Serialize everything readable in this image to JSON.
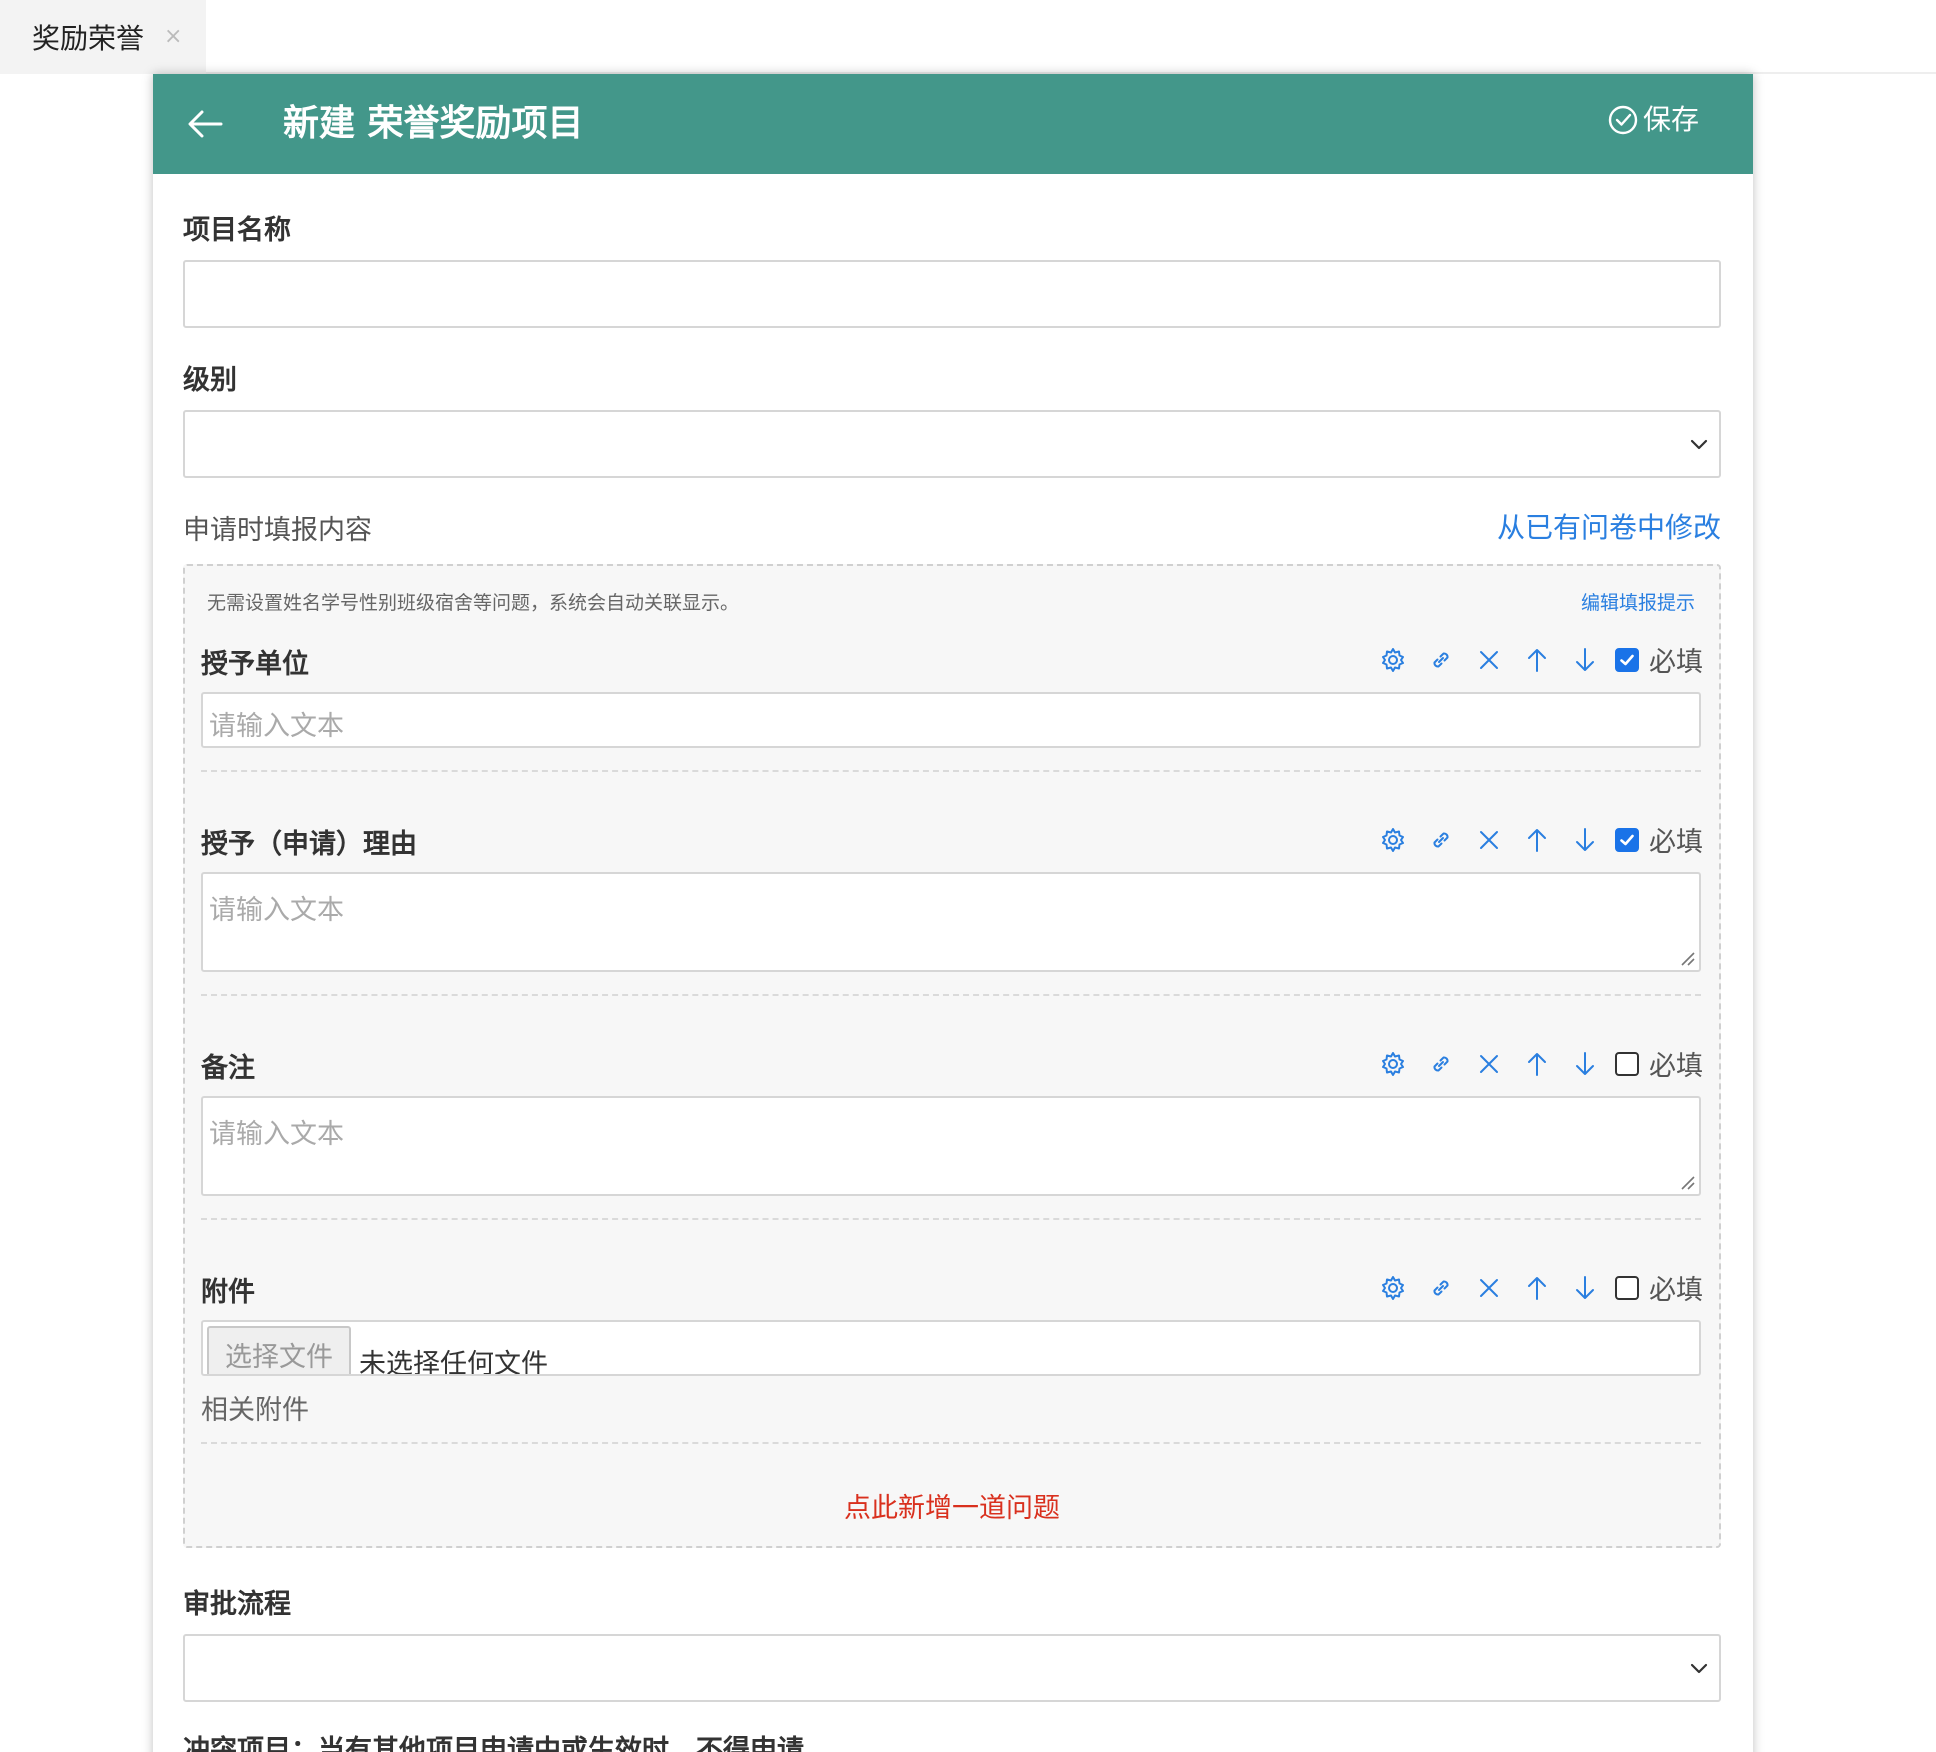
{
  "tabs": [
    {
      "label": "奖励荣誉",
      "close": "×"
    }
  ],
  "header": {
    "title": "新建 荣誉奖励项目",
    "save_label": "保存",
    "theme_color": "#43978a"
  },
  "form": {
    "name_label": "项目名称",
    "name_value": "",
    "level_label": "级别",
    "level_value": "",
    "content_label": "申请时填报内容",
    "modify_link": "从已有问卷中修改",
    "hint_text": "无需设置姓名学号性别班级宿舍等问题，系统会自动关联显示。",
    "edit_hint_link": "编辑填报提示",
    "required_label": "必填",
    "questions": [
      {
        "title": "授予单位",
        "placeholder": "请输入文本",
        "required": true,
        "type": "text"
      },
      {
        "title": "授予（申请）理由",
        "placeholder": "请输入文本",
        "required": true,
        "type": "textarea"
      },
      {
        "title": "备注",
        "placeholder": "请输入文本",
        "required": false,
        "type": "textarea"
      },
      {
        "title": "附件",
        "required": false,
        "type": "file",
        "file_button": "选择文件",
        "file_status": "未选择任何文件",
        "sub_label": "相关附件"
      }
    ],
    "add_question": "点此新增一道问题",
    "approval_label": "审批流程",
    "approval_value": "",
    "conflict_label": "冲突项目：当有其他项目申请中或生效时，不得申请"
  },
  "colors": {
    "accent_blue": "#2a7fe0",
    "checkbox_blue": "#1a73e8",
    "add_red": "#d9301e"
  }
}
